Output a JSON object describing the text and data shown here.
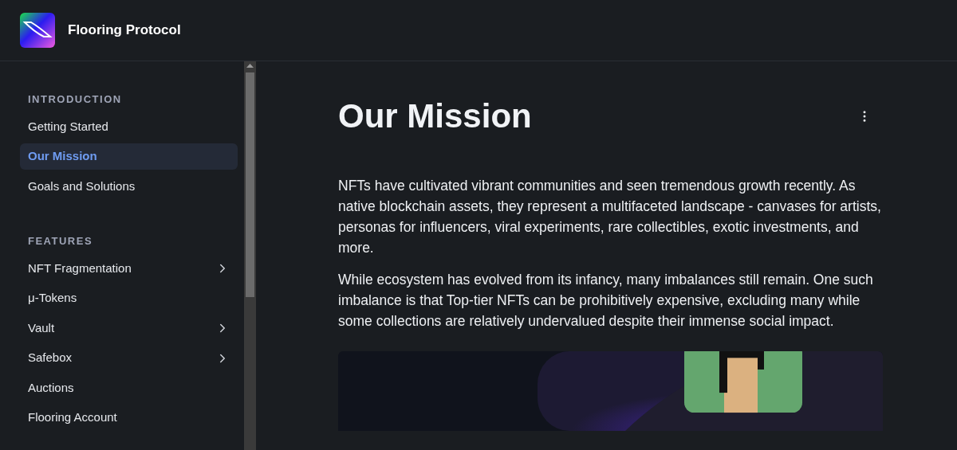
{
  "brand": {
    "name": "Flooring Protocol"
  },
  "sidebar": {
    "sections": [
      {
        "title": "INTRODUCTION",
        "items": [
          {
            "label": "Getting Started",
            "kind": "page",
            "selected": false
          },
          {
            "label": "Our Mission",
            "kind": "page",
            "selected": true
          },
          {
            "label": "Goals and Solutions",
            "kind": "page",
            "selected": false
          }
        ]
      },
      {
        "title": "FEATURES",
        "items": [
          {
            "label": "NFT Fragmentation",
            "kind": "group",
            "selected": false
          },
          {
            "label": "μ-Tokens",
            "kind": "page",
            "selected": false
          },
          {
            "label": "Vault",
            "kind": "group",
            "selected": false
          },
          {
            "label": "Safebox",
            "kind": "group",
            "selected": false
          },
          {
            "label": "Auctions",
            "kind": "page",
            "selected": false
          },
          {
            "label": "Flooring Account",
            "kind": "page",
            "selected": false
          }
        ]
      }
    ]
  },
  "page": {
    "title": "Our Mission",
    "paragraphs": [
      "NFTs have cultivated vibrant communities and seen tremendous growth recently. As native blockchain assets, they represent a multifaceted landscape - canvases for artists, personas for influencers, viral experiments, rare collectibles, exotic investments, and more.",
      "While ecosystem has evolved from its infancy, many imbalances still remain. One such imbalance is that Top-tier NFTs can be prohibitively expensive, excluding many while some collections are relatively undervalued despite their immense social impact."
    ],
    "image": {
      "kind": "picture"
    }
  }
}
